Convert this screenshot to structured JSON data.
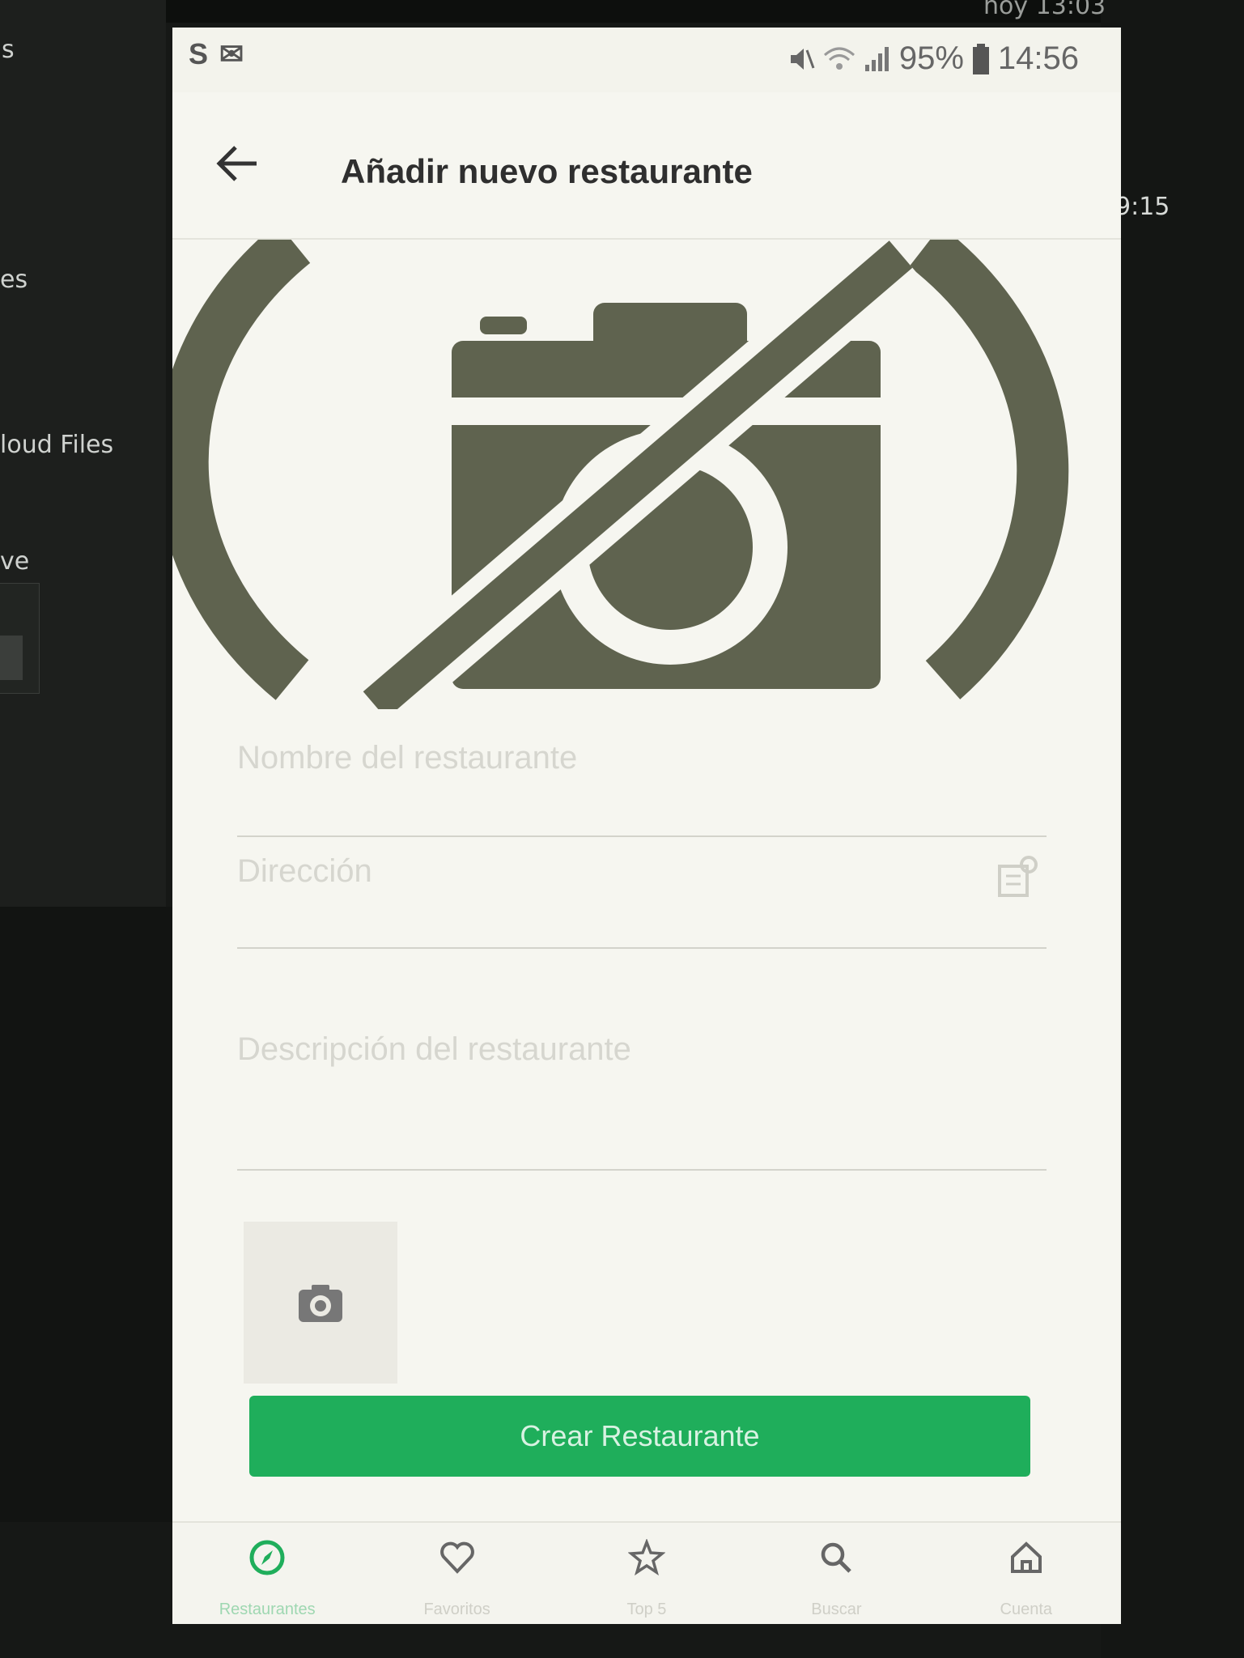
{
  "desktop": {
    "sidebar_items": [
      "s",
      "es",
      "loud Files",
      "ve"
    ],
    "time_top": "hoy 13:03",
    "time_right": "9:15"
  },
  "status_bar": {
    "left_icons": "S ✉",
    "battery": "95%",
    "time": "14:56"
  },
  "header": {
    "title": "Añadir nuevo restaurante"
  },
  "form": {
    "name_placeholder": "Nombre del restaurante",
    "address_placeholder": "Dirección",
    "description_placeholder": "Descripción del restaurante",
    "submit_label": "Crear Restaurante"
  },
  "bottom_nav": [
    {
      "label": "Restaurantes",
      "icon": "compass-icon",
      "active": true
    },
    {
      "label": "Favoritos",
      "icon": "heart-icon",
      "active": false
    },
    {
      "label": "Top 5",
      "icon": "star-icon",
      "active": false
    },
    {
      "label": "Buscar",
      "icon": "search-icon",
      "active": false
    },
    {
      "label": "Cuenta",
      "icon": "home-icon",
      "active": false
    }
  ],
  "colors": {
    "accent": "#1fae5b",
    "hero_icon": "#5f634f",
    "screen_bg": "#f6f6f0"
  }
}
